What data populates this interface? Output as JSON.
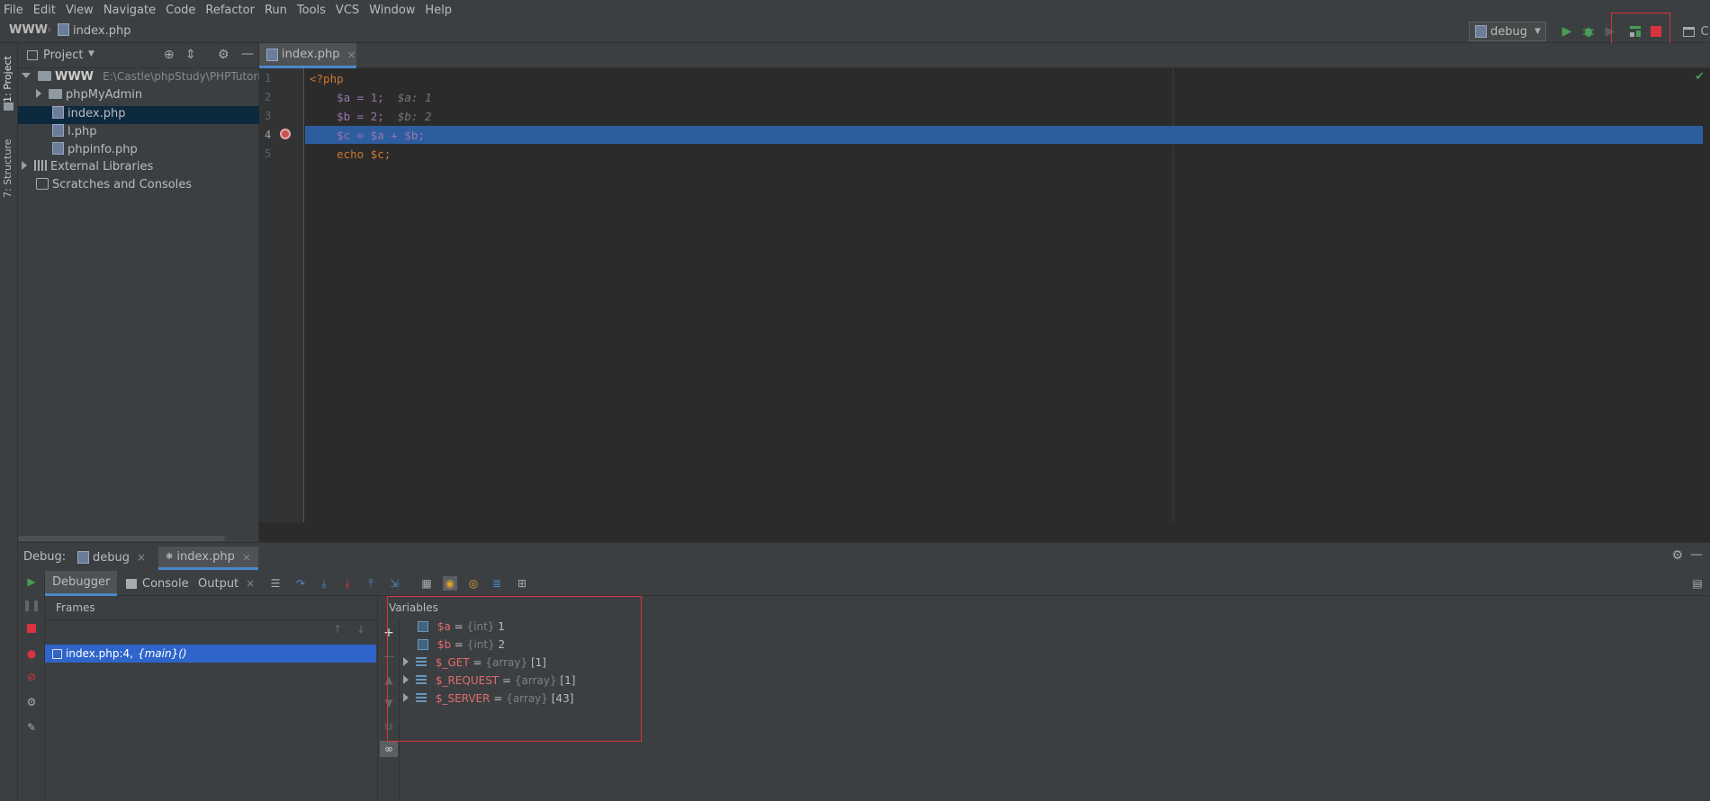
{
  "menu": [
    "File",
    "Edit",
    "View",
    "Navigate",
    "Code",
    "Refactor",
    "Run",
    "Tools",
    "VCS",
    "Window",
    "Help"
  ],
  "breadcrumb": {
    "root": "WWW",
    "file": "index.php"
  },
  "run_config": {
    "label": "debug"
  },
  "colors": {
    "accent": "#2d5d9f",
    "red": "#d9333f",
    "green": "#499c54"
  },
  "left_tabs": {
    "project": "1: Project",
    "structure": "7: Structure"
  },
  "project": {
    "title": "Project",
    "root": {
      "name": "WWW",
      "path": "E:\\Castle\\phpStudy\\PHPTutorial\\"
    },
    "items": [
      "phpMyAdmin",
      "index.php",
      "l.php",
      "phpinfo.php"
    ],
    "external": "External Libraries",
    "scratches": "Scratches and Consoles"
  },
  "editor": {
    "tab": "index.php",
    "lines": [
      {
        "n": "1",
        "code": "<?php"
      },
      {
        "n": "2",
        "code": "    $a = 1;",
        "inline": "$a: 1"
      },
      {
        "n": "3",
        "code": "    $b = 2;",
        "inline": "$b: 2"
      },
      {
        "n": "4",
        "code": "    $c = $a + $b;"
      },
      {
        "n": "5",
        "code": "    echo $c;"
      }
    ]
  },
  "debug": {
    "label": "Debug:",
    "tabs": [
      "debug",
      "index.php"
    ],
    "subtabs": [
      "Debugger",
      "Console",
      "Output"
    ],
    "frames_title": "Frames",
    "frame": {
      "loc": "index.php:4,",
      "fn": "{main}()"
    },
    "vars_title": "Variables",
    "variables": [
      {
        "name": "$a",
        "type": "{int}",
        "value": "1",
        "expandable": false
      },
      {
        "name": "$b",
        "type": "{int}",
        "value": "2",
        "expandable": false
      },
      {
        "name": "$_GET",
        "type": "{array}",
        "value": "[1]",
        "expandable": true
      },
      {
        "name": "$_REQUEST",
        "type": "{array}",
        "value": "[1]",
        "expandable": true
      },
      {
        "name": "$_SERVER",
        "type": "{array}",
        "value": "[43]",
        "expandable": true
      }
    ]
  }
}
